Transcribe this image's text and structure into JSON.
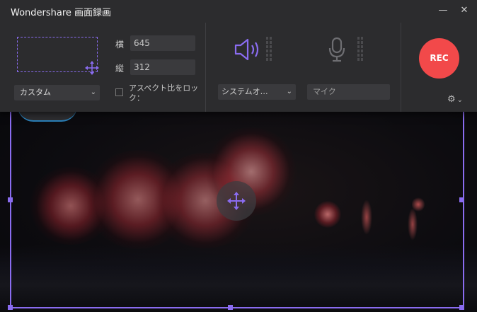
{
  "app": {
    "title": "Wondershare 画面録画"
  },
  "window_controls": {
    "minimize": "—",
    "close": "✕"
  },
  "region": {
    "preset_label": "カスタム",
    "width_label": "横",
    "width_value": "645",
    "height_label": "縦",
    "height_value": "312",
    "aspect_lock_label": "アスペクト比をロック："
  },
  "audio": {
    "system_audio_label": "システムオ…",
    "microphone_label": "マイク"
  },
  "record": {
    "rec_label": "REC"
  },
  "colors": {
    "accent": "#8a6cf0",
    "rec": "#f2494a",
    "panel": "#2c2c2e"
  },
  "icons": {
    "speaker": "speaker-icon",
    "microphone": "microphone-icon",
    "settings": "gear-icon",
    "move": "move-arrows-icon"
  }
}
